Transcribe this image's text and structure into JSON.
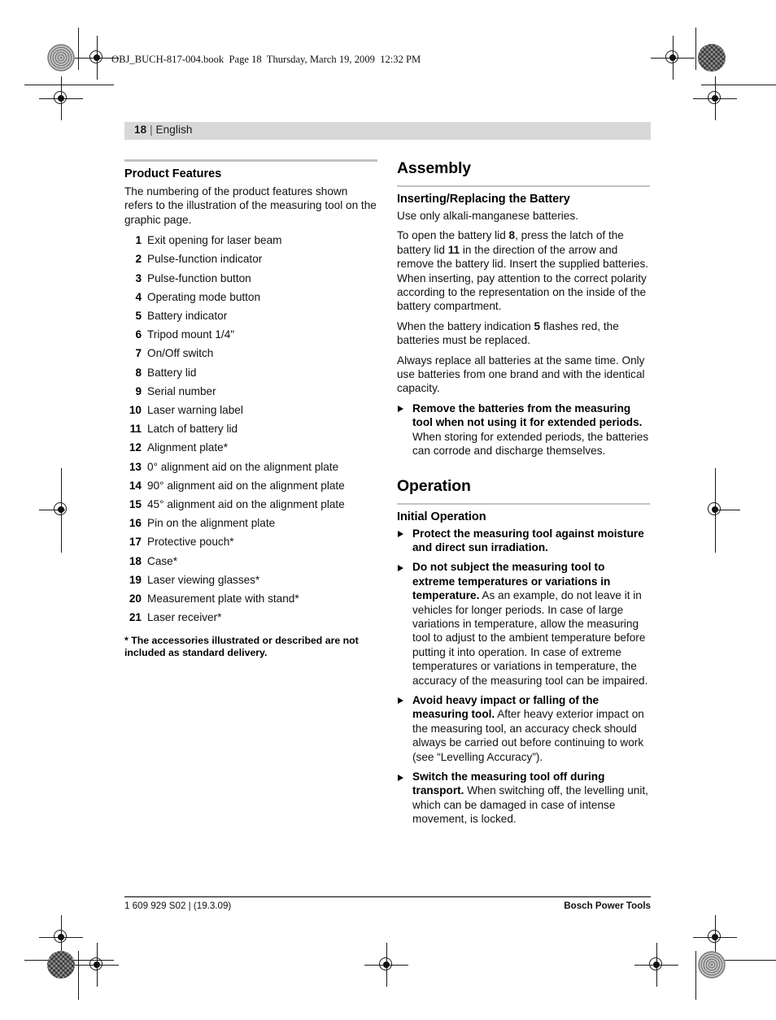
{
  "slug": "OBJ_BUCH-817-004.book  Page 18  Thursday, March 19, 2009  12:32 PM",
  "header": {
    "page_number": "18",
    "separator": "|",
    "language": "English"
  },
  "left_column": {
    "heading": "Product Features",
    "intro": "The numbering of the product features shown refers to the illustration of the measuring tool on the graphic page.",
    "features": [
      {
        "num": "1",
        "label": "Exit opening for laser beam"
      },
      {
        "num": "2",
        "label": "Pulse-function indicator"
      },
      {
        "num": "3",
        "label": "Pulse-function button"
      },
      {
        "num": "4",
        "label": "Operating mode button"
      },
      {
        "num": "5",
        "label": "Battery indicator"
      },
      {
        "num": "6",
        "label": "Tripod mount 1/4\""
      },
      {
        "num": "7",
        "label": "On/Off switch"
      },
      {
        "num": "8",
        "label": "Battery lid"
      },
      {
        "num": "9",
        "label": "Serial number"
      },
      {
        "num": "10",
        "label": "Laser warning label"
      },
      {
        "num": "11",
        "label": "Latch of battery lid"
      },
      {
        "num": "12",
        "label": "Alignment plate*"
      },
      {
        "num": "13",
        "label": "0° alignment aid on the alignment plate"
      },
      {
        "num": "14",
        "label": "90° alignment aid on the alignment plate"
      },
      {
        "num": "15",
        "label": "45° alignment aid on the alignment plate"
      },
      {
        "num": "16",
        "label": "Pin on the alignment plate"
      },
      {
        "num": "17",
        "label": "Protective pouch*"
      },
      {
        "num": "18",
        "label": "Case*"
      },
      {
        "num": "19",
        "label": "Laser viewing glasses*"
      },
      {
        "num": "20",
        "label": "Measurement plate with stand*"
      },
      {
        "num": "21",
        "label": "Laser receiver*"
      }
    ],
    "footnote": "* The accessories illustrated or described are not included as standard delivery."
  },
  "right_column": {
    "assembly": {
      "heading": "Assembly",
      "subheading": "Inserting/Replacing the Battery",
      "paragraphs": [
        {
          "parts": [
            {
              "text": "Use only alkali-manganese batteries.",
              "bold": false
            }
          ]
        },
        {
          "parts": [
            {
              "text": "To open the battery lid ",
              "bold": false
            },
            {
              "text": "8",
              "bold": true
            },
            {
              "text": ", press the latch of the battery lid ",
              "bold": false
            },
            {
              "text": "11",
              "bold": true
            },
            {
              "text": " in the direction of the arrow and remove the battery lid. Insert the supplied batteries. When inserting, pay attention to the correct polarity according to the representation on the inside of the battery compartment.",
              "bold": false
            }
          ]
        },
        {
          "parts": [
            {
              "text": "When the battery indication ",
              "bold": false
            },
            {
              "text": "5",
              "bold": true
            },
            {
              "text": " flashes red, the batteries must be replaced.",
              "bold": false
            }
          ]
        },
        {
          "parts": [
            {
              "text": "Always replace all batteries at the same time. Only use batteries from one brand and with the identical capacity.",
              "bold": false
            }
          ]
        }
      ],
      "warnings": [
        {
          "parts": [
            {
              "text": "Remove the batteries from the measuring tool when not using it for extended periods.",
              "bold": true
            },
            {
              "text": " When storing for extended periods, the batteries can corrode and discharge themselves.",
              "bold": false
            }
          ]
        }
      ]
    },
    "operation": {
      "heading": "Operation",
      "subheading": "Initial Operation",
      "warnings": [
        {
          "parts": [
            {
              "text": "Protect the measuring tool against moisture and direct sun irradiation.",
              "bold": true
            }
          ]
        },
        {
          "parts": [
            {
              "text": "Do not subject the measuring tool to extreme temperatures or variations in temperature.",
              "bold": true
            },
            {
              "text": " As an example, do not leave it in vehicles for longer periods. In case of large variations in temperature, allow the measuring tool to adjust to the ambient temperature before putting it into operation. In case of extreme temperatures or variations in temperature, the accuracy of the measuring tool can be impaired.",
              "bold": false
            }
          ]
        },
        {
          "parts": [
            {
              "text": "Avoid heavy impact or falling of the measuring tool.",
              "bold": true
            },
            {
              "text": " After heavy exterior impact on the measuring tool, an accuracy check should always be carried out before continuing to work (see “Levelling Accuracy”).",
              "bold": false
            }
          ]
        },
        {
          "parts": [
            {
              "text": "Switch the measuring tool off during transport.",
              "bold": true
            },
            {
              "text": " When switching off, the levelling unit, which can be damaged in case of intense movement, is locked.",
              "bold": false
            }
          ]
        }
      ]
    }
  },
  "footer": {
    "left": "1 609 929 S02 | (19.3.09)",
    "right": "Bosch Power Tools"
  },
  "colors": {
    "header_band": "#d8d8d8",
    "rule": "#c3c3c3",
    "text": "#111111"
  }
}
